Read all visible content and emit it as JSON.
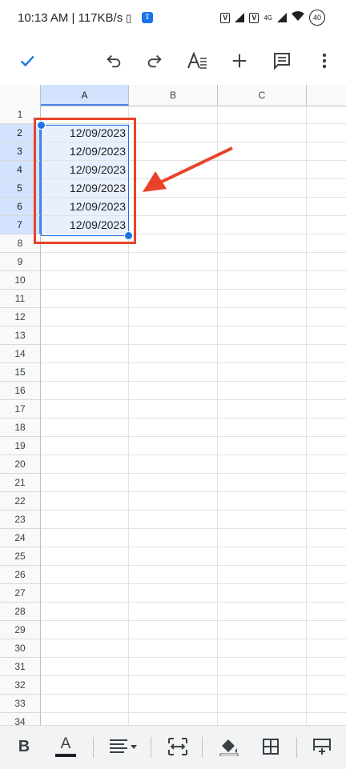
{
  "status_bar": {
    "time_net": "10:13 AM | 117KB/s",
    "battery": "40",
    "net_type": "4G",
    "sim1": "V",
    "sim2": "V"
  },
  "toolbar": {
    "icons": [
      "check-icon",
      "undo-icon",
      "redo-icon",
      "text-format-icon",
      "add-icon",
      "comment-icon",
      "more-vert-icon"
    ]
  },
  "sheet": {
    "columns": [
      "A",
      "B",
      "C"
    ],
    "selected_column": "A",
    "rows": [
      {
        "num": "1",
        "a": ""
      },
      {
        "num": "2",
        "a": "12/09/2023"
      },
      {
        "num": "3",
        "a": "12/09/2023"
      },
      {
        "num": "4",
        "a": "12/09/2023"
      },
      {
        "num": "5",
        "a": "12/09/2023"
      },
      {
        "num": "6",
        "a": "12/09/2023"
      },
      {
        "num": "7",
        "a": "12/09/2023"
      },
      {
        "num": "8",
        "a": ""
      },
      {
        "num": "9",
        "a": ""
      },
      {
        "num": "10",
        "a": ""
      },
      {
        "num": "11",
        "a": ""
      },
      {
        "num": "12",
        "a": ""
      },
      {
        "num": "13",
        "a": ""
      },
      {
        "num": "14",
        "a": ""
      },
      {
        "num": "15",
        "a": ""
      },
      {
        "num": "16",
        "a": ""
      },
      {
        "num": "17",
        "a": ""
      },
      {
        "num": "18",
        "a": ""
      },
      {
        "num": "19",
        "a": ""
      },
      {
        "num": "20",
        "a": ""
      },
      {
        "num": "21",
        "a": ""
      },
      {
        "num": "22",
        "a": ""
      },
      {
        "num": "23",
        "a": ""
      },
      {
        "num": "24",
        "a": ""
      },
      {
        "num": "25",
        "a": ""
      },
      {
        "num": "26",
        "a": ""
      },
      {
        "num": "27",
        "a": ""
      },
      {
        "num": "28",
        "a": ""
      },
      {
        "num": "29",
        "a": ""
      },
      {
        "num": "30",
        "a": ""
      },
      {
        "num": "31",
        "a": ""
      },
      {
        "num": "32",
        "a": ""
      },
      {
        "num": "33",
        "a": ""
      },
      {
        "num": "34",
        "a": ""
      }
    ],
    "selected_rows": [
      "2",
      "3",
      "4",
      "5",
      "6",
      "7"
    ]
  },
  "annotation": {
    "color": "#e8432a"
  },
  "accent_color": "#1a73e8",
  "bottom_bar": {
    "bold_label": "B",
    "text_color_label": "A",
    "icons": [
      "bold-icon",
      "text-color-icon",
      "align-icon",
      "merge-icon",
      "fill-color-icon",
      "borders-icon",
      "insert-row-icon"
    ]
  }
}
